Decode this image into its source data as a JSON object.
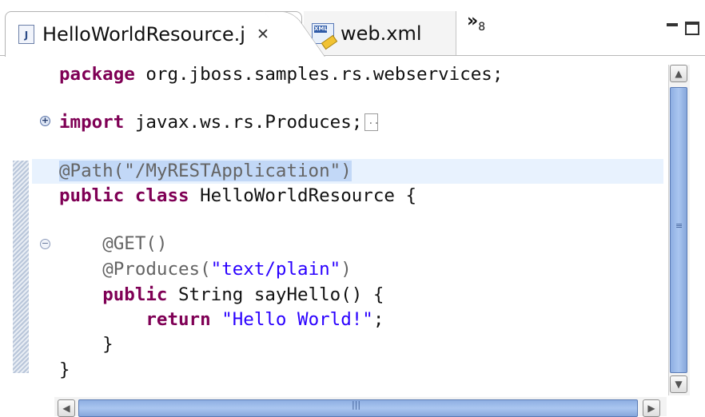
{
  "tabs": {
    "active": {
      "icon": "java-file-icon",
      "label": "HelloWorldResource.j"
    },
    "inactive": {
      "icon": "xml-file-icon",
      "label": "web.xml"
    },
    "overflow": {
      "chevron": "»",
      "count": "8"
    }
  },
  "code": {
    "line1": {
      "kw": "package",
      "text": " org.jboss.samples.rs.webservices;"
    },
    "line2": {
      "kw": "import",
      "text": " javax.ws.rs.Produces;"
    },
    "line3": {
      "annotation": "@Path(\"/MyRESTApplication\")"
    },
    "line4": {
      "kw1": "public",
      "kw2": "class",
      "text": " HelloWorldResource {"
    },
    "line5": {
      "indent": "    ",
      "annotation": "@GET()"
    },
    "line6": {
      "indent": "    ",
      "annotation": "@Produces(",
      "str": "\"text/plain\"",
      "tail": ")"
    },
    "line7": {
      "indent": "    ",
      "kw": "public",
      "text": " String sayHello() {"
    },
    "line8": {
      "indent": "        ",
      "kw": "return",
      "str": " \"Hello World!\"",
      "tail": ";"
    },
    "line9": {
      "text": "    }"
    },
    "line10": {
      "text": "}"
    }
  },
  "colors": {
    "keyword": "#7f0055",
    "string": "#2a00ff",
    "annotation": "#646464",
    "selection": "#c2d8f7"
  },
  "icons": [
    "close-icon",
    "minimize-icon",
    "maximize-icon",
    "fold-expand-icon",
    "fold-collapse-icon",
    "scroll-up-icon",
    "scroll-down-icon",
    "scroll-left-icon",
    "scroll-right-icon"
  ]
}
